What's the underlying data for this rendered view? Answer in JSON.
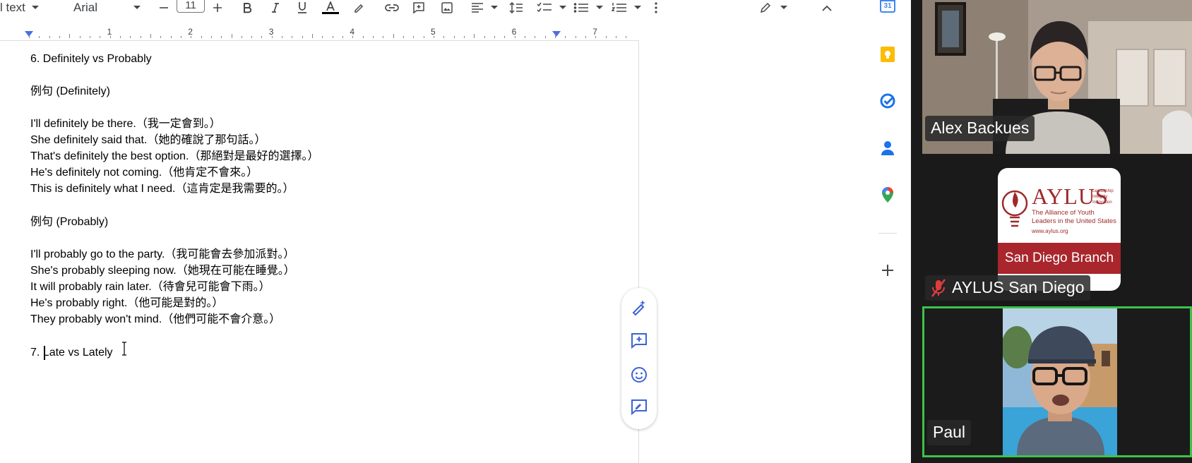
{
  "toolbar": {
    "style_label": "l text",
    "font_name": "Arial",
    "font_size": "11"
  },
  "ruler": {
    "numbers": [
      "1",
      "2",
      "3",
      "4",
      "5",
      "6",
      "7"
    ]
  },
  "document": {
    "lines": [
      "6. Definitely vs Probably",
      "例句 (Definitely)",
      "I'll definitely be there.（我一定會到。）",
      "She definitely said that.（她的確說了那句話。）",
      "That's definitely the best option.（那絕對是最好的選擇。）",
      "He's definitely not coming.（他肯定不會來。）",
      "This is definitely what I need.（這肯定是我需要的。）",
      "例句 (Probably)",
      "I'll probably go to the party.（我可能會去參加派對。）",
      "She's probably sleeping now.（她現在可能在睡覺。）",
      "It will probably rain later.（待會兒可能會下雨。）",
      "He's probably right.（他可能是對的。）",
      "They probably won't mind.（他們可能不會介意。）",
      "7. Late vs Lately"
    ]
  },
  "side_panel": {
    "calendar_day": "31"
  },
  "video": {
    "participants": [
      {
        "name": "Alex Backues",
        "muted": false
      },
      {
        "name": "AYLUS San Diego",
        "muted": true
      },
      {
        "name": "Paul",
        "muted": false,
        "active_speaker": true
      }
    ],
    "aylus_logo": {
      "title": "AYLUS",
      "tagline": [
        "Leadership",
        "Integrity",
        "Innovation"
      ],
      "subtitle": "The Alliance of Youth Leaders in the United States",
      "url": "www.aylus.org",
      "branch": "San Diego Branch"
    },
    "active_border_color": "#3ec24a"
  }
}
